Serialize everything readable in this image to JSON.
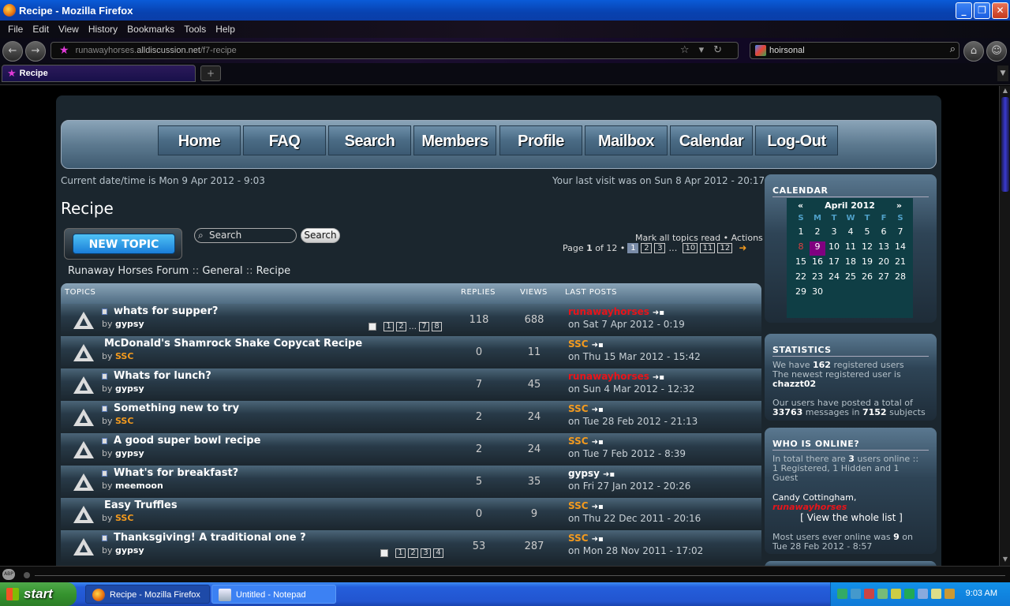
{
  "window": {
    "title": "Recipe - Mozilla Firefox"
  },
  "menu": [
    "File",
    "Edit",
    "View",
    "History",
    "Bookmarks",
    "Tools",
    "Help"
  ],
  "urlbar": {
    "prefix": "runawayhorses.",
    "domain": "alldiscussion.net",
    "path": "/f7-recipe"
  },
  "search": {
    "query": "hoirsonal"
  },
  "tab": {
    "label": "Recipe"
  },
  "forum": {
    "menu": [
      "Home",
      "FAQ",
      "Search",
      "Members",
      "Profile",
      "Mailbox",
      "Calendar",
      "Log-Out"
    ],
    "current_time": "Current date/time is Mon 9 Apr 2012 - 9:03",
    "last_visit": "Your last visit was on Sun 8 Apr 2012 - 20:17",
    "page_title": "Recipe",
    "new_topic": "NEW TOPIC",
    "search_placeholder": "Search",
    "search_button": "Search",
    "mark_all": "Mark all topics read",
    "actions": "Actions",
    "pagination": {
      "label": "Page",
      "current": "1",
      "of": "of",
      "total": "12",
      "pages": [
        "1",
        "2",
        "3",
        "…",
        "10",
        "11",
        "12"
      ]
    },
    "breadcrumb": [
      "Runaway Horses Forum",
      "General",
      "Recipe"
    ],
    "table_headers": {
      "topics": "TOPICS",
      "replies": "REPLIES",
      "views": "VIEWS",
      "last_posts": "LAST POSTS"
    },
    "topics": [
      {
        "title": "whats for supper?",
        "by": "gypsy",
        "replies": "118",
        "views": "688",
        "last_user": "runawayhorses",
        "last_date": "on Sat 7 Apr 2012 - 0:19",
        "pages": [
          "1",
          "2",
          "…",
          "7",
          "8"
        ]
      },
      {
        "title": "McDonald's Shamrock Shake Copycat Recipe",
        "by": "SSC",
        "replies": "0",
        "views": "11",
        "last_user": "SSC",
        "last_date": "on Thu 15 Mar 2012 - 15:42"
      },
      {
        "title": "Whats for lunch?",
        "by": "gypsy",
        "replies": "7",
        "views": "45",
        "last_user": "runawayhorses",
        "last_date": "on Sun 4 Mar 2012 - 12:32"
      },
      {
        "title": "Something new to try",
        "by": "SSC",
        "replies": "2",
        "views": "24",
        "last_user": "SSC",
        "last_date": "on Tue 28 Feb 2012 - 21:13"
      },
      {
        "title": "A good super bowl recipe",
        "by": "gypsy",
        "replies": "2",
        "views": "24",
        "last_user": "SSC",
        "last_date": "on Tue 7 Feb 2012 - 8:39"
      },
      {
        "title": "What's for breakfast?",
        "by": "meemoon",
        "replies": "5",
        "views": "35",
        "last_user": "gypsy",
        "last_date": "on Fri 27 Jan 2012 - 20:26"
      },
      {
        "title": "Easy Truffles",
        "by": "SSC",
        "replies": "0",
        "views": "9",
        "last_user": "SSC",
        "last_date": "on Thu 22 Dec 2011 - 20:16"
      },
      {
        "title": "Thanksgiving! A traditional one ?",
        "by": "gypsy",
        "replies": "53",
        "views": "287",
        "last_user": "SSC",
        "last_date": "on Mon 28 Nov 2011 - 17:02",
        "pages": [
          "1",
          "2",
          "3",
          "4"
        ]
      }
    ],
    "by_label": "by",
    "calendar": {
      "heading": "CALENDAR",
      "month": "April 2012",
      "prev": "«",
      "next": "»",
      "dow": [
        "S",
        "M",
        "T",
        "W",
        "T",
        "F",
        "S"
      ],
      "days": [
        "1",
        "2",
        "3",
        "4",
        "5",
        "6",
        "7",
        "8",
        "9",
        "10",
        "11",
        "12",
        "13",
        "14",
        "15",
        "16",
        "17",
        "18",
        "19",
        "20",
        "21",
        "22",
        "23",
        "24",
        "25",
        "26",
        "27",
        "28",
        "29",
        "30"
      ]
    },
    "statistics": {
      "heading": "STATISTICS",
      "l1a": "We have ",
      "users": "162",
      "l1b": " registered users",
      "l2": "The newest registered user is",
      "newest": "chazzt02",
      "l3": "Our users have posted a total of",
      "messages": "33763",
      "l4a": " messages in ",
      "subjects": "7152",
      "l4b": " subjects"
    },
    "online": {
      "heading": "WHO IS ONLINE?",
      "l1a": "In total there are ",
      "count": "3",
      "l1b": " users online ::",
      "l2": "1 Registered, 1 Hidden and 1",
      "l3": "Guest",
      "names_a": "Candy Cottingham, ",
      "names_b": "runawayhorses",
      "view_list": "[ View the whole list ]",
      "most_a": "Most users ever online was ",
      "most": "9",
      "most_b": " on",
      "most_date": "Tue 28 Feb 2012 - 8:57"
    }
  },
  "taskbar": {
    "start": "start",
    "tasks": [
      "Recipe - Mozilla Firefox",
      "Untitled - Notepad"
    ],
    "clock": "9:03 AM"
  },
  "status": {
    "abp": "ABP"
  }
}
